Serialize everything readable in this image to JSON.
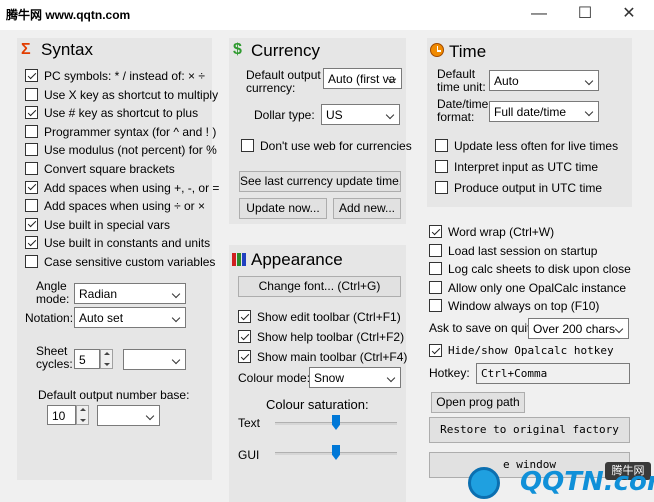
{
  "window": {
    "watermark_title": "腾牛网 www.qqtn.com",
    "minimize_glyph": "—",
    "maximize_glyph": "☐",
    "close_glyph": "✕"
  },
  "syntax": {
    "title": "Syntax",
    "icon_glyph": "Σ",
    "icon_color": "#e23d00",
    "options": [
      {
        "label": "PC symbols: * / instead of: × ÷",
        "checked": true
      },
      {
        "label": "Use X key as shortcut to multiply",
        "checked": false
      },
      {
        "label": "Use # key as shortcut to plus",
        "checked": true
      },
      {
        "label": "Programmer syntax (for ^ and ! )",
        "checked": false
      },
      {
        "label": "Use modulus (not percent) for %",
        "checked": false
      },
      {
        "label": "Convert square brackets",
        "checked": false
      },
      {
        "label": "Add spaces when using +, -, or =",
        "checked": true
      },
      {
        "label": "Add spaces when using ÷ or ×",
        "checked": false
      },
      {
        "label": "Use built in special vars",
        "checked": true
      },
      {
        "label": "Use built in constants and units",
        "checked": true
      },
      {
        "label": "Case sensitive custom variables",
        "checked": false
      }
    ],
    "angle_mode_label_1": "Angle",
    "angle_mode_label_2": "mode:",
    "angle_mode_value": "Radian",
    "notation_label": "Notation:",
    "notation_value": "Auto set",
    "sheet_cycles_label_1": "Sheet",
    "sheet_cycles_label_2": "cycles:",
    "sheet_cycles_value": "5",
    "sheet_cycles_dropdown": "",
    "output_base_label": "Default output number base:",
    "output_base_value": "10",
    "output_base_dropdown": ""
  },
  "currency": {
    "title": "Currency",
    "icon_glyph": "$",
    "icon_color": "#2f9a2f",
    "default_output_label_1": "Default output",
    "default_output_label_2": "currency:",
    "default_output_value": "Auto (first va",
    "dollar_type_label": "Dollar type:",
    "dollar_type_value": "US",
    "no_web_label": "Don't use web for currencies",
    "no_web_checked": false,
    "see_last_update_button": "See last currency update time...",
    "update_now_button": "Update now...",
    "add_new_button": "Add new..."
  },
  "appearance": {
    "title": "Appearance",
    "change_font_button": "Change font... (Ctrl+G)",
    "toolbars": [
      {
        "label": "Show edit toolbar (Ctrl+F1)",
        "checked": true
      },
      {
        "label": "Show help toolbar (Ctrl+F2)",
        "checked": true
      },
      {
        "label": "Show main toolbar (Ctrl+F4)",
        "checked": true
      }
    ],
    "colour_mode_label": "Colour mode:",
    "colour_mode_value": "Snow",
    "colour_saturation_label": "Colour saturation:",
    "text_label": "Text",
    "gui_label": "GUI",
    "text_saturation": 0.5,
    "gui_saturation": 0.5
  },
  "time": {
    "title": "Time",
    "icon_glyph": "🕓",
    "icon_color": "#e07000",
    "default_unit_label_1": "Default",
    "default_unit_label_2": "time unit:",
    "default_unit_value": "Auto",
    "format_label_1": "Date/time",
    "format_label_2": "format:",
    "format_value": "Full date/time",
    "options": [
      {
        "label": "Update less often for live times",
        "checked": false
      },
      {
        "label": "Interpret input as UTC time",
        "checked": false
      },
      {
        "label": "Produce output in UTC time",
        "checked": false
      }
    ]
  },
  "general": {
    "options": [
      {
        "label": "Word wrap (Ctrl+W)",
        "checked": true
      },
      {
        "label": "Load last session on startup",
        "checked": false
      },
      {
        "label": "Log calc sheets to disk upon close",
        "checked": false
      },
      {
        "label": "Allow only one OpalCalc instance",
        "checked": false
      },
      {
        "label": "Window always on top (F10)",
        "checked": false
      }
    ],
    "ask_save_label": "Ask to save on quit:",
    "ask_save_value": "Over 200 chars",
    "hotkey_option": {
      "label": "Hide/show Opalcalc hotkey",
      "checked": true
    },
    "hotkey_label": "Hotkey:",
    "hotkey_value": "Ctrl+Comma",
    "open_prog_path_button": "Open prog path",
    "restore_button": "Restore to original factory",
    "close_button_partial": "e window"
  },
  "watermarks": {
    "site_small": "腾牛网",
    "site_logo": "QQTN.com"
  }
}
